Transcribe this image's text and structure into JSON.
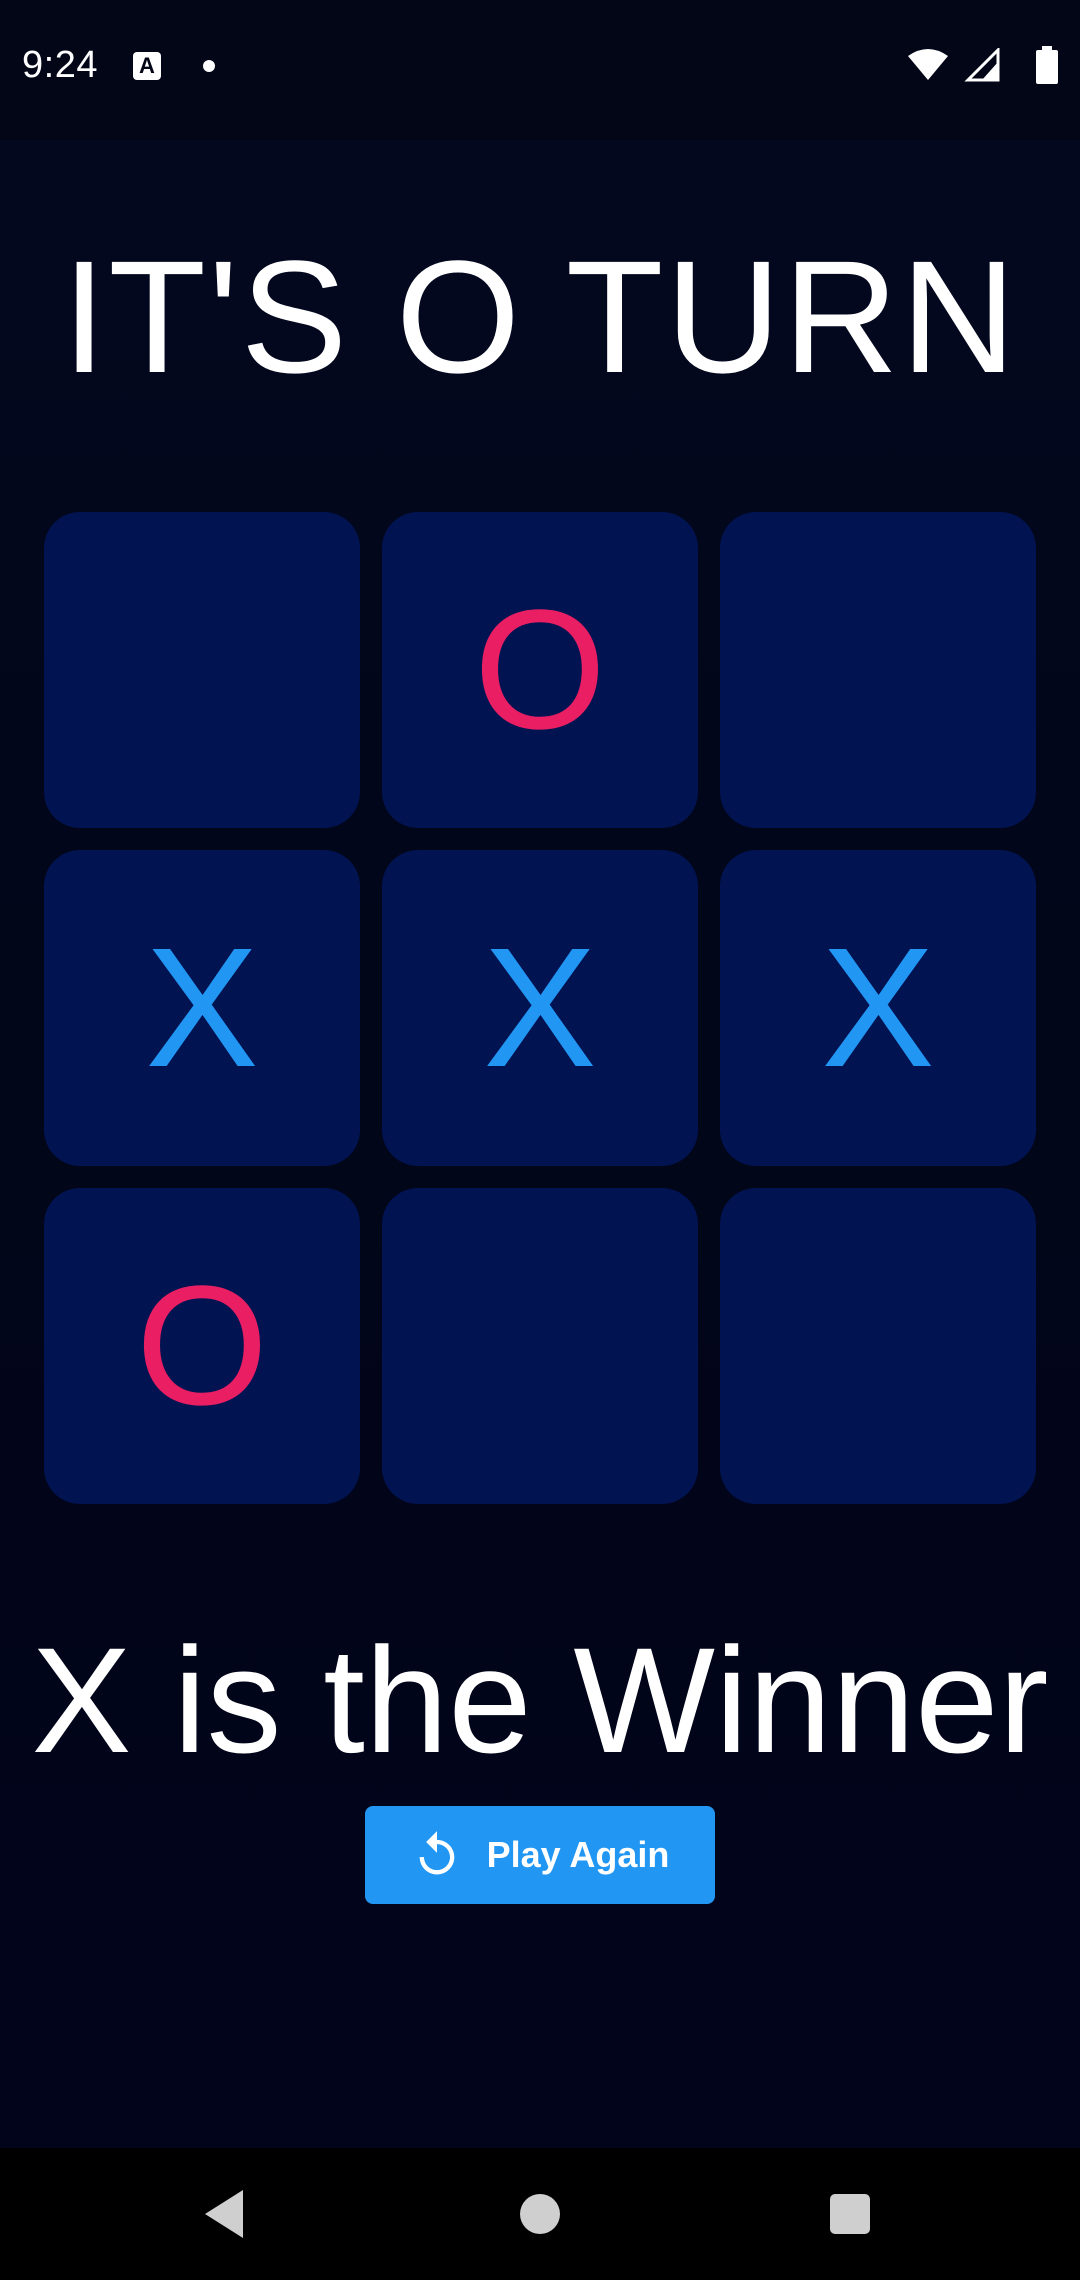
{
  "status_bar": {
    "time": "9:24",
    "icons": [
      "keyboard-a-icon",
      "notification-dot-icon",
      "wifi-icon",
      "signal-icon",
      "battery-icon"
    ]
  },
  "game": {
    "turn_title": "IT'S O TURN",
    "board": [
      [
        "",
        "O",
        ""
      ],
      [
        "X",
        "X",
        "X"
      ],
      [
        "O",
        "",
        ""
      ]
    ],
    "winner_text": "X is the Winner",
    "play_again_label": "Play Again",
    "play_again_icon": "refresh-icon"
  },
  "colors": {
    "background": "#020617",
    "cell": "#021352",
    "x_mark": "#2196f3",
    "o_mark": "#e91e63",
    "button": "#2196f3"
  },
  "nav_bar": {
    "icons": [
      "back-icon",
      "home-icon",
      "recents-icon"
    ]
  }
}
